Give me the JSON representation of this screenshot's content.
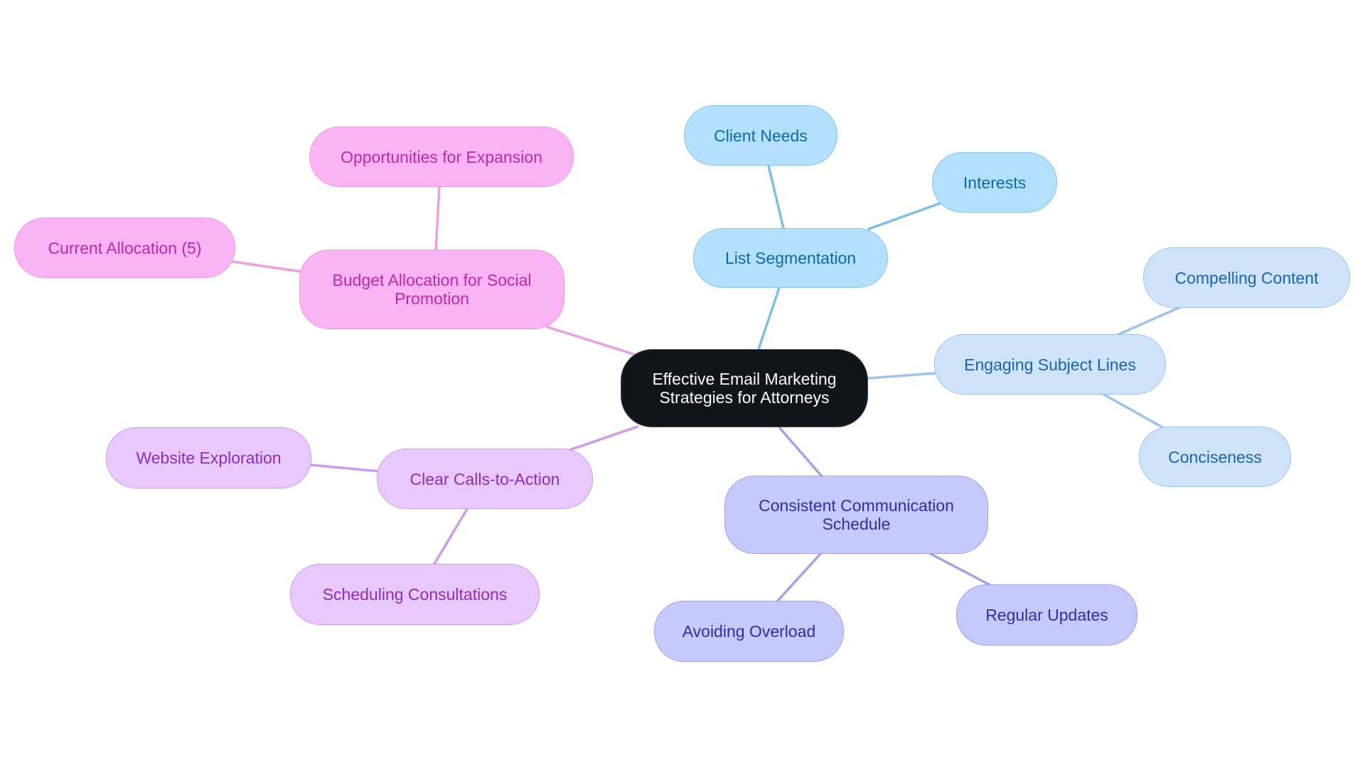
{
  "diagram": {
    "type": "mindmap",
    "root": {
      "id": "root",
      "label": "Effective Email Marketing Strategies for Attorneys",
      "lines": [
        "Effective Email Marketing",
        "Strategies for Attorneys"
      ],
      "colors": {
        "fill": "#0f151b",
        "border": "#4a4f55",
        "text": "#ffffff"
      }
    },
    "branches": [
      {
        "id": "list-segmentation",
        "label": "List Segmentation",
        "lines": [
          "List Segmentation"
        ],
        "colors": {
          "fill": "#b3e0fd",
          "border": "#86c4ea",
          "text": "#0d6aae",
          "edge": "#7fbfe6"
        },
        "children": [
          {
            "id": "client-needs",
            "label": "Client Needs",
            "lines": [
              "Client Needs"
            ]
          },
          {
            "id": "interests",
            "label": "Interests",
            "lines": [
              "Interests"
            ]
          }
        ]
      },
      {
        "id": "engaging-subject-lines",
        "label": "Engaging Subject Lines",
        "lines": [
          "Engaging Subject Lines"
        ],
        "colors": {
          "fill": "#cfe4fb",
          "border": "#9cc3ec",
          "text": "#1a63b3",
          "edge": "#9cc3ec"
        },
        "children": [
          {
            "id": "compelling-content",
            "label": "Compelling Content",
            "lines": [
              "Compelling Content"
            ]
          },
          {
            "id": "conciseness",
            "label": "Conciseness",
            "lines": [
              "Conciseness"
            ]
          }
        ]
      },
      {
        "id": "consistent-communication-schedule",
        "label": "Consistent Communication Schedule",
        "lines": [
          "Consistent Communication",
          "Schedule"
        ],
        "colors": {
          "fill": "#c6c9fc",
          "border": "#9ea3ea",
          "text": "#2e2fa4",
          "edge": "#9ea3ea"
        },
        "children": [
          {
            "id": "avoiding-overload",
            "label": "Avoiding Overload",
            "lines": [
              "Avoiding Overload"
            ]
          },
          {
            "id": "regular-updates",
            "label": "Regular Updates",
            "lines": [
              "Regular Updates"
            ]
          }
        ]
      },
      {
        "id": "clear-calls-to-action",
        "label": "Clear Calls-to-Action",
        "lines": [
          "Clear Calls-to-Action"
        ],
        "colors": {
          "fill": "#e9c9fd",
          "border": "#cc9ceb",
          "text": "#8a2ec0",
          "edge": "#cc9ceb"
        },
        "children": [
          {
            "id": "website-exploration",
            "label": "Website Exploration",
            "lines": [
              "Website Exploration"
            ]
          },
          {
            "id": "scheduling-consultations",
            "label": "Scheduling Consultations",
            "lines": [
              "Scheduling Consultations"
            ]
          }
        ]
      },
      {
        "id": "budget-allocation",
        "label": "Budget Allocation for Social Promotion",
        "lines": [
          "Budget Allocation for Social",
          "Promotion"
        ],
        "colors": {
          "fill": "#fbb4f3",
          "border": "#ec9be2",
          "text": "#bb2aa9",
          "edge": "#eb9ee0"
        },
        "children": [
          {
            "id": "opportunities-for-expansion",
            "label": "Opportunities for Expansion",
            "lines": [
              "Opportunities for Expansion"
            ]
          },
          {
            "id": "current-allocation",
            "label": "Current Allocation (5)",
            "lines": [
              "Current Allocation (5)"
            ]
          }
        ]
      }
    ]
  }
}
